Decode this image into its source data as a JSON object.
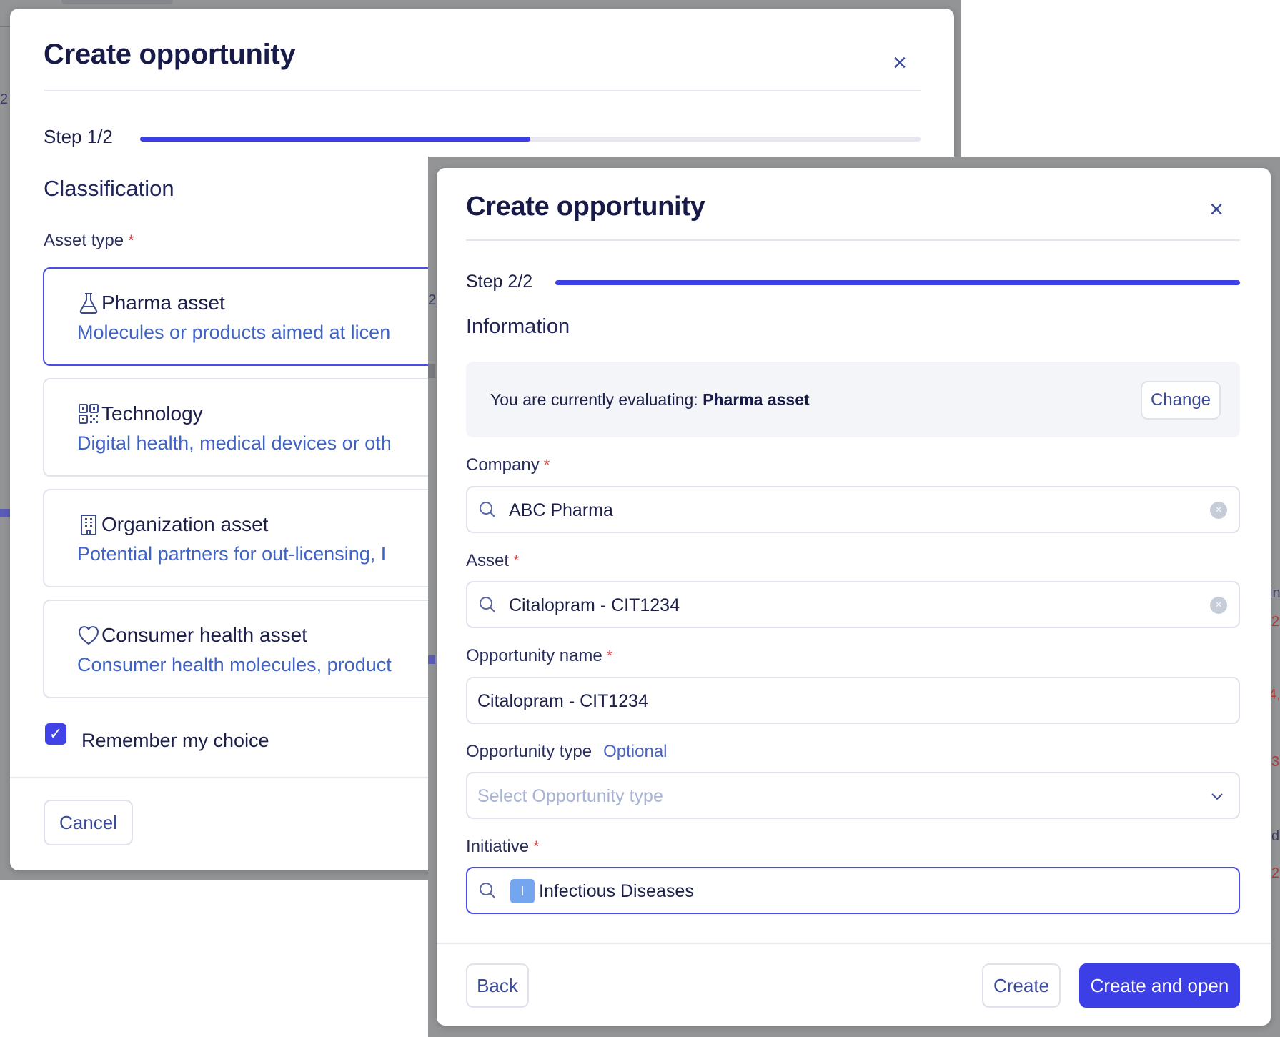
{
  "step1": {
    "title": "Create opportunity",
    "close_icon": "close-icon",
    "step_label": "Step 1/2",
    "progress": 0.5,
    "section": "Classification",
    "asset_type_label": "Asset type",
    "required_mark": "*",
    "cards": [
      {
        "icon": "flask-icon",
        "title": "Pharma asset",
        "desc": "Molecules or products aimed at licen",
        "selected": true
      },
      {
        "icon": "qr-grid-icon",
        "title": "Technology",
        "desc": "Digital health, medical devices or oth",
        "selected": false
      },
      {
        "icon": "building-icon",
        "title": "Organization asset",
        "desc": "Potential partners for out-licensing, I",
        "selected": false
      },
      {
        "icon": "heart-icon",
        "title": "Consumer health asset",
        "desc": "Consumer health molecules, product",
        "selected": false
      }
    ],
    "remember_label": "Remember my choice",
    "remember_checked": true,
    "cancel_label": "Cancel"
  },
  "step2": {
    "title": "Create opportunity",
    "step_label": "Step 2/2",
    "progress": 1.0,
    "section": "Information",
    "evaluating_prefix": "You are currently evaluating:",
    "evaluating_value": "Pharma asset",
    "change_label": "Change",
    "fields": {
      "company": {
        "label": "Company",
        "value": "ABC Pharma"
      },
      "asset": {
        "label": "Asset",
        "value": "Citalopram - CIT1234"
      },
      "opportunity_name": {
        "label": "Opportunity name",
        "value": "Citalopram - CIT1234"
      },
      "opportunity_type": {
        "label": "Opportunity type",
        "optional": "Optional",
        "placeholder": "Select Opportunity type"
      },
      "initiative": {
        "label": "Initiative",
        "chip": "I",
        "value": "Infectious Diseases"
      }
    },
    "required_mark": "*",
    "back_label": "Back",
    "create_label": "Create",
    "create_open_label": "Create and open"
  },
  "backdrop_fragments": [
    "2",
    "2",
    "In",
    "2",
    "4,",
    "3",
    "d",
    "2"
  ],
  "colors": {
    "accent": "#3d3fe6",
    "backdrop": "#939496",
    "link": "#3f63c4",
    "required": "#e0484a"
  }
}
